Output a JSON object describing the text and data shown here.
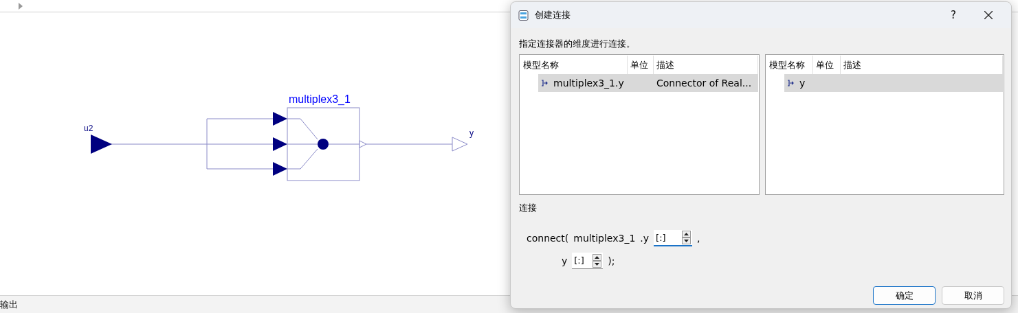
{
  "diagram": {
    "input_label": "u2",
    "component_label": "multiplex3_1",
    "output_label": "y"
  },
  "status_bar": {
    "label": "输出"
  },
  "dialog": {
    "title": "创建连接",
    "help": "?",
    "instruction": "指定连接器的维度进行连接。",
    "left_table": {
      "columns": [
        "模型名称",
        "单位",
        "描述"
      ],
      "rows": [
        {
          "name": "multiplex3_1.y",
          "description": "Connector of Real...",
          "selected": true
        }
      ]
    },
    "right_table": {
      "columns": [
        "模型名称",
        "单位",
        "描述"
      ],
      "rows": [
        {
          "name": "y",
          "selected": true
        }
      ]
    },
    "connection_label": "连接",
    "connect": {
      "open": "connect(",
      "from_component": "multiplex3_1",
      "from_port": ".y",
      "from_index": {
        "value": "[:]",
        "focused": true
      },
      "separator": ",",
      "to_port": "y",
      "to_index": {
        "value": "[:]",
        "focused": false
      },
      "close": ");"
    },
    "buttons": [
      {
        "label": "确定",
        "default": true
      },
      {
        "label": "取消",
        "default": false
      }
    ]
  }
}
